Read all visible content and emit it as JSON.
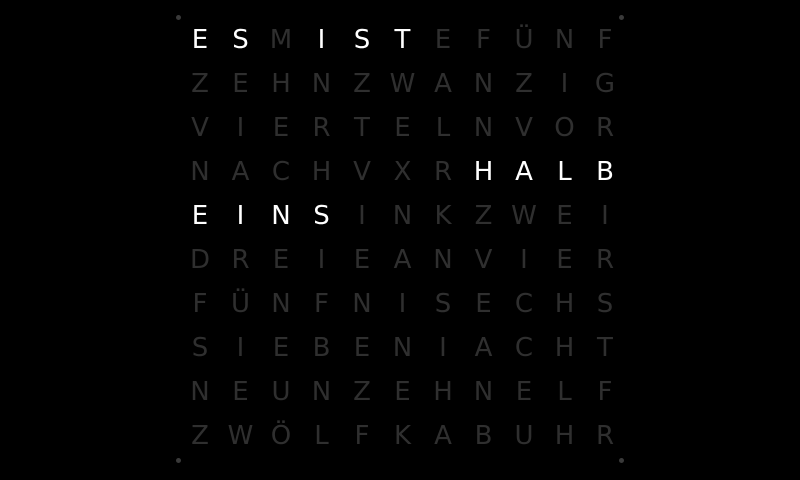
{
  "clock": {
    "rows": [
      "ESMISTEFÜNF",
      "ZEHNZWANZIG",
      "VIERTELNVOR",
      "NACHVXRHALB",
      "EINSINKZWEI",
      "DREIEANVIER",
      "FÜNFNISECHS",
      "SIEBENIACHT",
      "NEUNZEHNELF",
      "ZWÖLFKABUHR"
    ],
    "lit": [
      [
        0,
        1,
        3,
        4,
        5
      ],
      [],
      [],
      [
        7,
        8,
        9,
        10
      ],
      [
        0,
        1,
        2,
        3
      ],
      [],
      [],
      [],
      [],
      []
    ],
    "lit_words": [
      "ES",
      "IST",
      "HALB",
      "EINS"
    ],
    "colors": {
      "background": "#000000",
      "lit": "#ffffff",
      "unlit": "#2f2f2f",
      "corner_dots": "#3a3a3a"
    }
  }
}
